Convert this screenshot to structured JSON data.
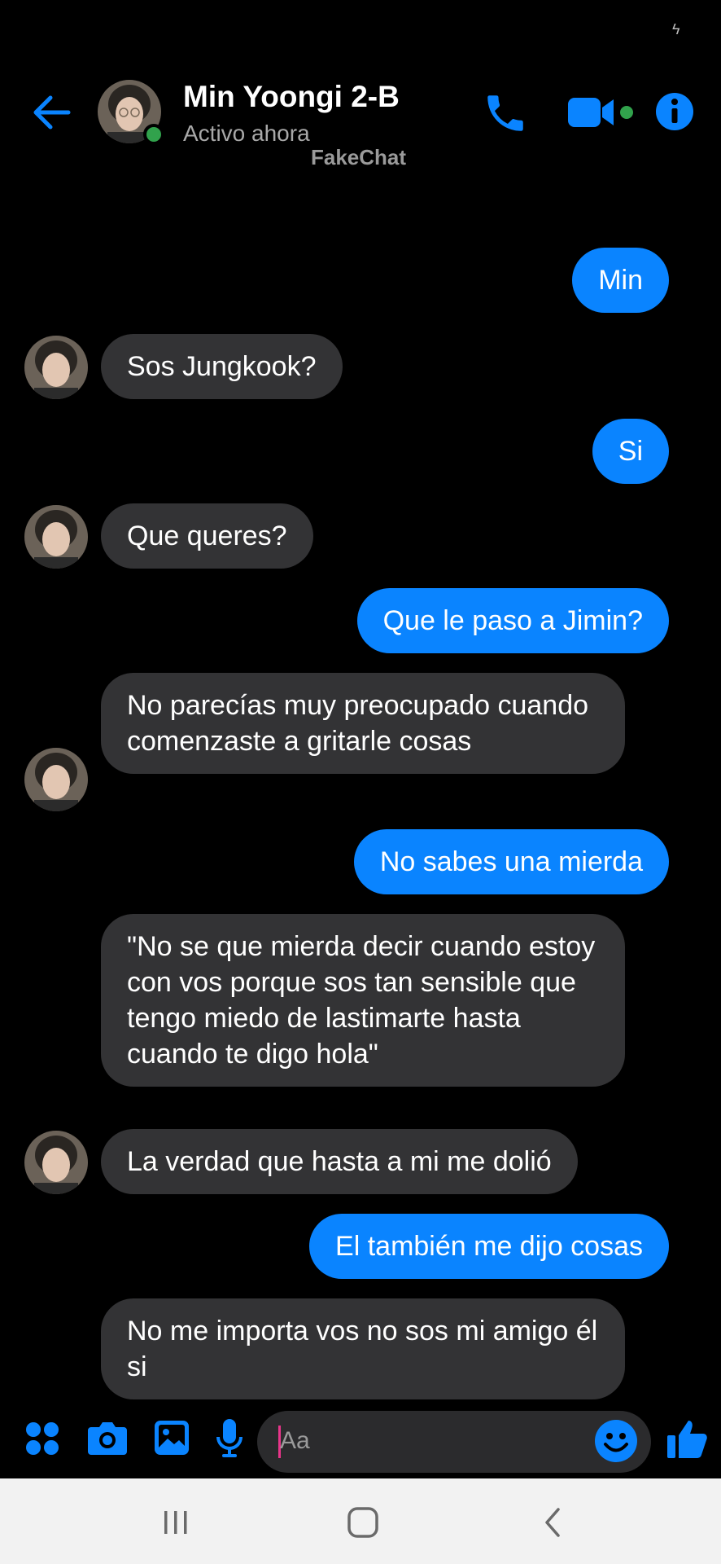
{
  "colors": {
    "accent": "#0a84ff",
    "bubble_incoming": "#333335",
    "online": "#31a24c"
  },
  "header": {
    "contact_name": "Min Yoongi 2-B",
    "status": "Activo ahora",
    "watermark": "FakeChat",
    "icons": [
      "back-arrow-icon",
      "phone-icon",
      "video-camera-icon",
      "info-icon"
    ]
  },
  "messages": [
    {
      "from": "me",
      "text": "Min"
    },
    {
      "from": "them",
      "text": "Sos Jungkook?"
    },
    {
      "from": "me",
      "text": "Si"
    },
    {
      "from": "them",
      "text": "Que queres?"
    },
    {
      "from": "me",
      "text": "Que le paso a Jimin?"
    },
    {
      "from": "them",
      "text": "No parecías muy preocupado cuando comenzaste a gritarle cosas"
    },
    {
      "from": "me",
      "text": "No sabes una mierda"
    },
    {
      "from": "them",
      "text": "\"No se que mierda decir cuando estoy con vos porque sos tan sensible que tengo miedo de lastimarte hasta cuando te digo hola\""
    },
    {
      "from": "them",
      "text": "La verdad que hasta a mi me dolió"
    },
    {
      "from": "me",
      "text": "El también me dijo cosas"
    },
    {
      "from": "them",
      "text": "No me importa vos no sos mi amigo él si"
    }
  ],
  "composer": {
    "placeholder": "Aa",
    "icons": [
      "apps-icon",
      "camera-icon",
      "gallery-icon",
      "microphone-icon",
      "emoji-icon",
      "thumbs-up-icon"
    ]
  },
  "navbar": {
    "icons": [
      "recents-icon",
      "home-icon",
      "back-icon"
    ]
  }
}
